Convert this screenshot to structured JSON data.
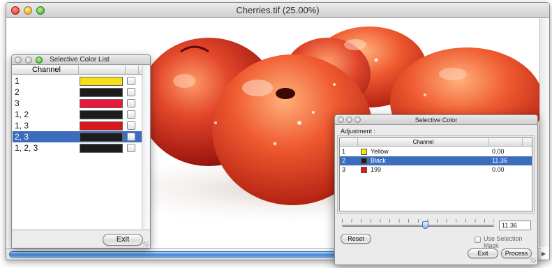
{
  "main_window": {
    "title": "Cherries.tif (25.00%)"
  },
  "selective_color_list": {
    "title": "Selective Color List",
    "column_header": "Channel",
    "rows": [
      {
        "label": "1",
        "color": "#f7e01a",
        "checked": false,
        "selected": false
      },
      {
        "label": "2",
        "color": "#1c1c1c",
        "checked": false,
        "selected": false
      },
      {
        "label": "3",
        "color": "#e8193c",
        "checked": false,
        "selected": false
      },
      {
        "label": "1, 2",
        "color": "#1c1c1c",
        "checked": false,
        "selected": false
      },
      {
        "label": "1, 3",
        "color": "#d8171c",
        "checked": false,
        "selected": false
      },
      {
        "label": "2, 3",
        "color": "#1c1c1c",
        "checked": false,
        "selected": true
      },
      {
        "label": "1, 2, 3",
        "color": "#1c1c1c",
        "checked": false,
        "selected": false
      }
    ],
    "exit_label": "Exit"
  },
  "selective_color": {
    "title": "Selective Color",
    "adjustment_label": "Adjustment :",
    "column_header": "Channel",
    "rows": [
      {
        "num": "1",
        "name": "Yellow",
        "color": "#f7e01a",
        "value": "0.00",
        "selected": false
      },
      {
        "num": "2",
        "name": "Black",
        "color": "#1c1c1c",
        "value": "11.36",
        "selected": true
      },
      {
        "num": "3",
        "name": "199",
        "color": "#e01a1c",
        "value": "0.00",
        "selected": false
      }
    ],
    "slider_value": "11.36",
    "slider_fraction": 0.55,
    "reset_label": "Reset",
    "use_selection_mask_label": "Use Selection Mask",
    "use_selection_mask_checked": false,
    "exit_label": "Exit",
    "process_label": "Process"
  },
  "colors": {
    "selection_blue": "#3c6cbd",
    "cherry_red": "#d8321c"
  }
}
